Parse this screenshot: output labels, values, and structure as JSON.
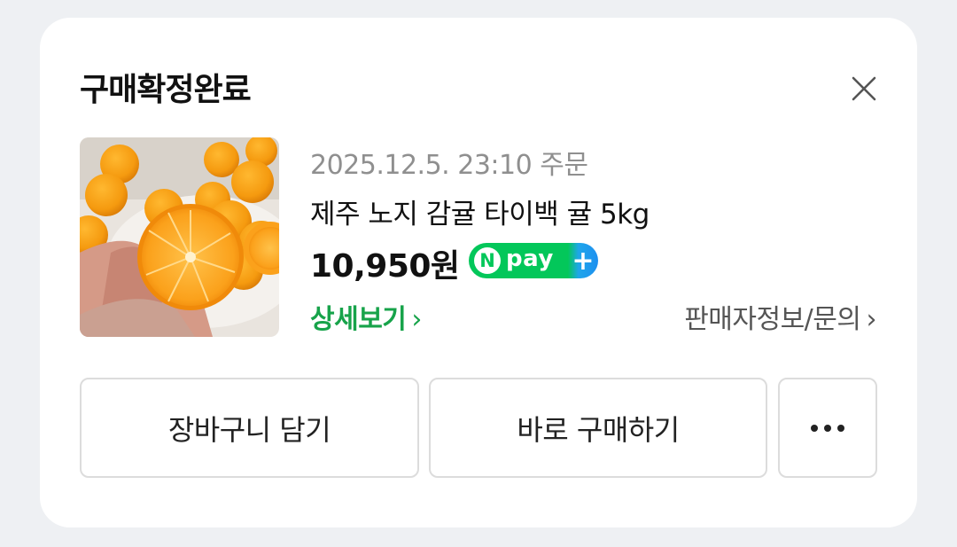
{
  "modal": {
    "title": "구매확정완료"
  },
  "order": {
    "date_text": "2025.12.5. 23:10 주문",
    "product_name": "제주 노지 감귤 타이백 귤 5kg",
    "price": "10,950원",
    "npay_badge": {
      "n": "N",
      "pay": "pay",
      "plus": "+"
    },
    "detail_link": "상세보기",
    "seller_link": "판매자정보/문의",
    "chevron": "›"
  },
  "actions": {
    "cart_label": "장바구니 담기",
    "buy_label": "바로 구매하기",
    "more_icon": "more-horizontal-icon"
  },
  "colors": {
    "accent_green": "#17a34a",
    "npay_green": "#03c75a",
    "npay_blue": "#1d8ff0"
  }
}
